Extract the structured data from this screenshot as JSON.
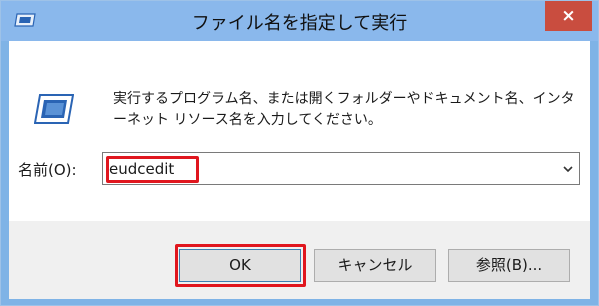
{
  "window": {
    "title": "ファイル名を指定して実行",
    "close_label": "×"
  },
  "dialog": {
    "description": "実行するプログラム名、または開くフォルダーやドキュメント名、インターネット リソース名を入力してください。",
    "field_label": "名前(O):",
    "field_value": "eudcedit"
  },
  "buttons": {
    "ok": "OK",
    "cancel": "キャンセル",
    "browse": "参照(B)..."
  },
  "colors": {
    "titlebar": "#8ab8ec",
    "close": "#c94d3f",
    "highlight": "#e0161e",
    "icon_blue": "#2a64b4"
  },
  "icons": {
    "app": "run-dialog-icon",
    "run": "run-program-icon",
    "dropdown": "chevron-down-icon"
  }
}
